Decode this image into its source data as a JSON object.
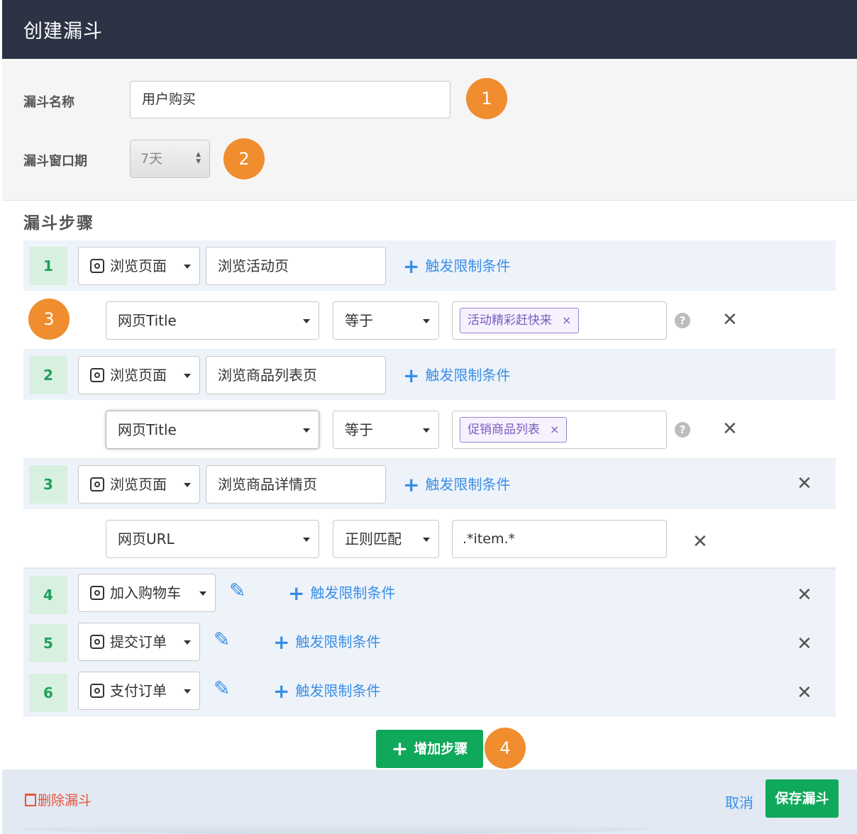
{
  "header": {
    "title": "创建漏斗"
  },
  "settings": {
    "name_label": "漏斗名称",
    "name_value": "用户购买",
    "window_label": "漏斗窗口期",
    "window_value": "7天"
  },
  "badges": [
    "1",
    "2",
    "3",
    "4"
  ],
  "steps_title": "漏斗步骤",
  "add_condition_label": "触发限制条件",
  "steps": [
    {
      "number": "1",
      "event": "浏览页面",
      "page": "浏览活动页",
      "condition": {
        "field": "网页Title",
        "operator": "等于",
        "tag": "活动精彩赶快来",
        "tag_remove": "×",
        "help": "?",
        "remove": "✕"
      }
    },
    {
      "number": "2",
      "event": "浏览页面",
      "page": "浏览商品列表页",
      "condition": {
        "field": "网页Title",
        "operator": "等于",
        "tag": "促销商品列表",
        "tag_remove": "×",
        "help": "?",
        "remove": "✕"
      }
    },
    {
      "number": "3",
      "event": "浏览页面",
      "page": "浏览商品详情页",
      "remove": "✕",
      "condition": {
        "field": "网页URL",
        "operator": "正则匹配",
        "value": ".*item.*",
        "remove": "✕"
      }
    },
    {
      "number": "4",
      "event": "加入购物车",
      "remove": "✕"
    },
    {
      "number": "5",
      "event": "提交订单",
      "remove": "✕"
    },
    {
      "number": "6",
      "event": "支付订单",
      "remove": "✕"
    }
  ],
  "add_step_label": "增加步骤",
  "footer": {
    "delete_label": "删除漏斗",
    "cancel_label": "取消",
    "save_label": "保存漏斗"
  },
  "icons": {
    "event": "event-target-icon",
    "edit": "pencil-icon",
    "plus": "plus-icon",
    "close": "close-icon",
    "help": "help-icon",
    "trash": "trash-icon"
  },
  "colors": {
    "header_bg": "#2c3344",
    "accent_green": "#10a85a",
    "badge_orange": "#f08d2f",
    "link_blue": "#3a8ee6",
    "danger": "#e8533a"
  }
}
